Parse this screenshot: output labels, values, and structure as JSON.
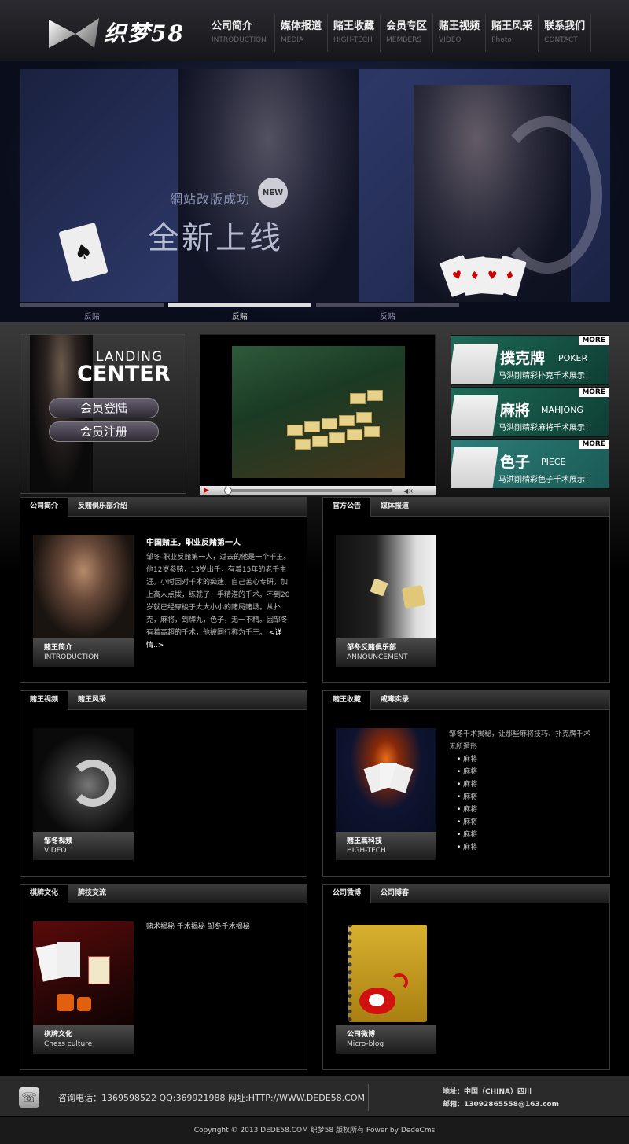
{
  "logo": {
    "text": "织梦58"
  },
  "nav": [
    {
      "cn": "公司简介",
      "en": "INTRODUCTION"
    },
    {
      "cn": "媒体报道",
      "en": "MEDIA"
    },
    {
      "cn": "赌王收藏",
      "en": "HIGH-TECH"
    },
    {
      "cn": "会员专区",
      "en": "MEMBERS"
    },
    {
      "cn": "赌王视频",
      "en": "VIDEO"
    },
    {
      "cn": "赌王风采",
      "en": "Photo"
    },
    {
      "cn": "联系我们",
      "en": "CONTACT"
    }
  ],
  "banner": {
    "small_text": "網站改版成功",
    "big_text": "全新上线",
    "badge": "NEW",
    "tabs": [
      "反赌",
      "反赌",
      "反赌"
    ]
  },
  "landing": {
    "title1": "LANDING",
    "title2": "CENTER",
    "login": "会员登陆",
    "register": "会员注册"
  },
  "promos": [
    {
      "more": "MORE",
      "title": "撲克牌",
      "en": "POKER",
      "sub": "马洪刚精彩扑克千术展示！"
    },
    {
      "more": "MORE",
      "title": "麻將",
      "en": "MAHJONG",
      "sub": "马洪刚精彩麻将千术展示！"
    },
    {
      "more": "MORE",
      "title": "色子",
      "en": "PIECE",
      "sub": "马洪刚精彩色子千术展示！"
    }
  ],
  "panels": {
    "intro": {
      "tabs": [
        "公司简介",
        "反赌俱乐部介绍"
      ],
      "heading": "中国赌王，职业反赌第一人",
      "body": "邹冬-职业反赌第一人，过去的他是一个千王。他12岁参赌，13岁出千，有着15年的老千生涯。小时因对千术的痴迷，自己苦心专研，加上高人点拨，练就了一手精湛的千术。不到20岁就已经穿梭于大大小小的赌局赌场。从扑克，麻将，到牌九，色子，无一不精。因邹冬有着高超的千术，他被同行称为千王。",
      "more": "<详情..>",
      "caption_cn": "赌王简介",
      "caption_en": "INTRODUCTION"
    },
    "announce": {
      "tabs": [
        "官方公告",
        "媒体报道"
      ],
      "caption_cn": "邹冬反赌俱乐部",
      "caption_en": "ANNOUNCEMENT"
    },
    "video": {
      "tabs": [
        "赌王视频",
        "赌王风采"
      ],
      "caption_cn": "邹冬视频",
      "caption_en": "VIDEO"
    },
    "collection": {
      "tabs": [
        "赌王收藏",
        "戒毒实录"
      ],
      "intro": "邹冬千术揭秘，让那些麻将技巧、扑克牌千术无所遁形",
      "items": [
        "麻将",
        "麻将",
        "麻将",
        "麻将",
        "麻将",
        "麻将",
        "麻将",
        "麻将"
      ],
      "caption_cn": "赌王高科技",
      "caption_en": "HIGH-TECH"
    },
    "chess": {
      "tabs": [
        "棋牌文化",
        "牌技交流"
      ],
      "text": "赌术揭秘 千术揭秘 邹冬千术揭秘",
      "caption_cn": "棋牌文化",
      "caption_en": "Chess culture"
    },
    "weibo": {
      "tabs": [
        "公司微博",
        "公司博客"
      ],
      "caption_cn": "公司微博",
      "caption_en": "Micro-blog"
    }
  },
  "footer": {
    "contact": "咨询电话：1369598522 QQ:369921988 网址:HTTP://WWW.DEDE58.COM",
    "address": "地址：中国（CHINA）四川",
    "email": "邮箱：13092865558@163.com",
    "copyright": "Copyright © 2013 DEDE58.COM 织梦58 版权所有 Power by DedeCms"
  },
  "colors": {
    "background": "#000000",
    "accent": "#dddddd",
    "promo": "#1e6a56"
  }
}
